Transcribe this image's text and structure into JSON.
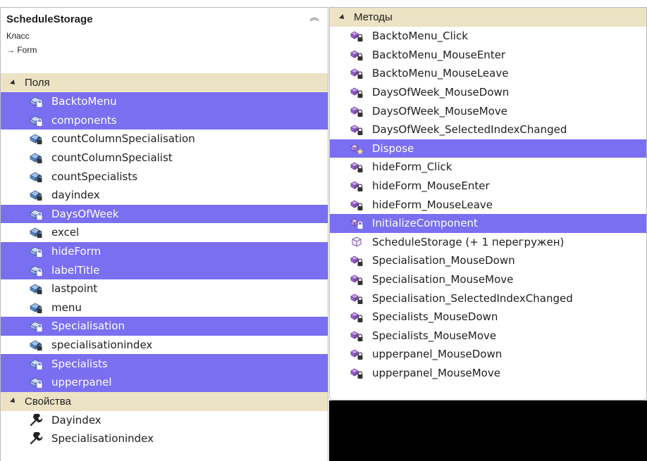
{
  "class_panel": {
    "title": "ScheduleStorage",
    "kind": "Класс",
    "base": "→ Form",
    "collapse_glyph": "︽"
  },
  "fields_section": {
    "label": "Поля",
    "items": [
      {
        "name": "BacktoMenu",
        "selected": true
      },
      {
        "name": "components",
        "selected": true
      },
      {
        "name": "countColumnSpecialisation",
        "selected": false
      },
      {
        "name": "countColumnSpecialist",
        "selected": false
      },
      {
        "name": "countSpecialists",
        "selected": false
      },
      {
        "name": "dayindex",
        "selected": false
      },
      {
        "name": "DaysOfWeek",
        "selected": true
      },
      {
        "name": "excel",
        "selected": false
      },
      {
        "name": "hideForm",
        "selected": true
      },
      {
        "name": "labelTitle",
        "selected": true
      },
      {
        "name": "lastpoint",
        "selected": false
      },
      {
        "name": "menu",
        "selected": false
      },
      {
        "name": "Specialisation",
        "selected": true
      },
      {
        "name": "specialisationindex",
        "selected": false
      },
      {
        "name": "Specialists",
        "selected": true
      },
      {
        "name": "upperpanel",
        "selected": true
      }
    ]
  },
  "properties_section": {
    "label": "Свойства",
    "items": [
      {
        "name": "Dayindex"
      },
      {
        "name": "Specialisationindex"
      }
    ]
  },
  "methods_section": {
    "label": "Методы",
    "items": [
      {
        "name": "BacktoMenu_Click",
        "selected": false,
        "icon": "method-private-icon"
      },
      {
        "name": "BacktoMenu_MouseEnter",
        "selected": false,
        "icon": "method-private-icon"
      },
      {
        "name": "BacktoMenu_MouseLeave",
        "selected": false,
        "icon": "method-private-icon"
      },
      {
        "name": "DaysOfWeek_MouseDown",
        "selected": false,
        "icon": "method-private-icon"
      },
      {
        "name": "DaysOfWeek_MouseMove",
        "selected": false,
        "icon": "method-private-icon"
      },
      {
        "name": "DaysOfWeek_SelectedIndexChanged",
        "selected": false,
        "icon": "method-private-icon"
      },
      {
        "name": "Dispose",
        "selected": true,
        "icon": "method-protected-icon"
      },
      {
        "name": "hideForm_Click",
        "selected": false,
        "icon": "method-private-icon"
      },
      {
        "name": "hideForm_MouseEnter",
        "selected": false,
        "icon": "method-private-icon"
      },
      {
        "name": "hideForm_MouseLeave",
        "selected": false,
        "icon": "method-private-icon"
      },
      {
        "name": "InitializeComponent",
        "selected": true,
        "icon": "method-private-icon"
      },
      {
        "name": "ScheduleStorage (+ 1 перегружен)",
        "selected": false,
        "icon": "constructor-icon"
      },
      {
        "name": "Specialisation_MouseDown",
        "selected": false,
        "icon": "method-private-icon"
      },
      {
        "name": "Specialisation_MouseMove",
        "selected": false,
        "icon": "method-private-icon"
      },
      {
        "name": "Specialisation_SelectedIndexChanged",
        "selected": false,
        "icon": "method-private-icon"
      },
      {
        "name": "Specialists_MouseDown",
        "selected": false,
        "icon": "method-private-icon"
      },
      {
        "name": "Specialists_MouseMove",
        "selected": false,
        "icon": "method-private-icon"
      },
      {
        "name": "upperpanel_MouseDown",
        "selected": false,
        "icon": "method-private-icon"
      },
      {
        "name": "upperpanel_MouseMove",
        "selected": false,
        "icon": "method-private-icon"
      }
    ]
  },
  "colors": {
    "selection": "#7a6ff0",
    "section_header": "#ece3c4",
    "field_icon": "#4f7fbf",
    "method_icon": "#8a5fb8"
  }
}
